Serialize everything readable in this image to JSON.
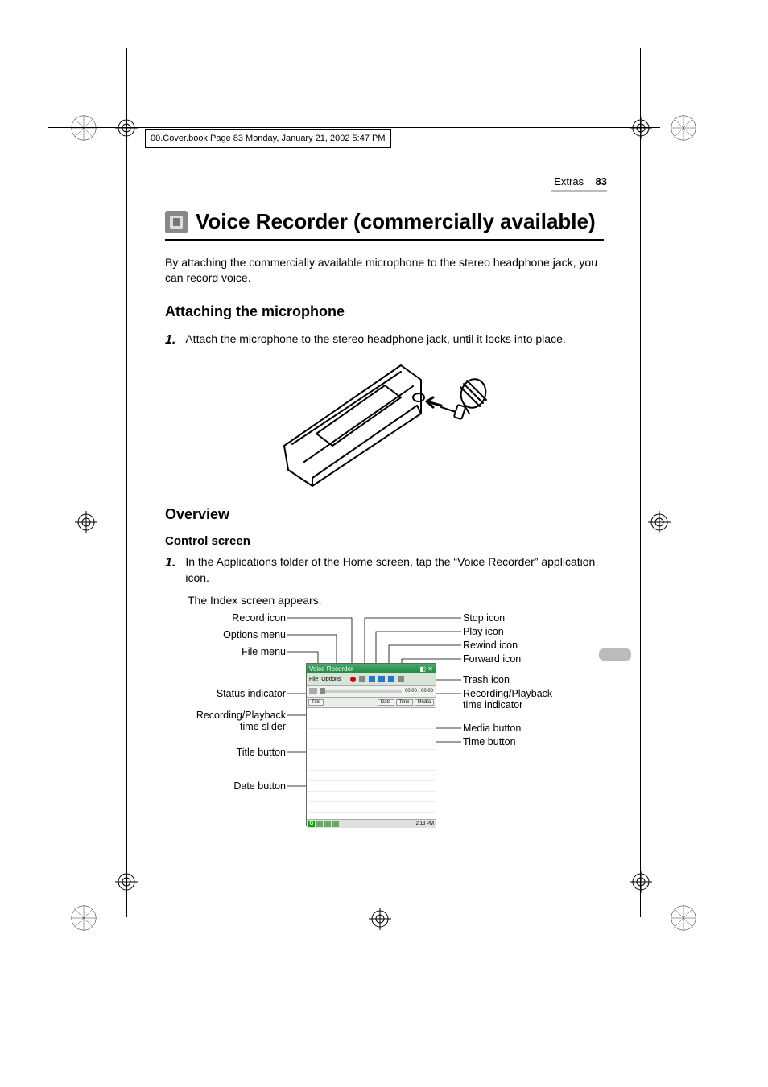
{
  "frame_header": "00.Cover.book  Page 83  Monday, January 21, 2002  5:47 PM",
  "section": {
    "label": "Extras",
    "page": "83"
  },
  "title": "Voice Recorder (commercially available)",
  "intro": "By attaching the commercially available microphone to the stereo headphone jack, you can record voice.",
  "h2_attach": "Attaching the microphone",
  "step_attach": "Attach the microphone to the stereo headphone jack, until it locks into place.",
  "h2_overview": "Overview",
  "h3_control": "Control screen",
  "step_control": "In the Applications folder of the Home screen, tap the “Voice Recorder” application icon.",
  "caption_index": "The Index screen appears.",
  "labels": {
    "left": {
      "record": "Record icon",
      "options": "Options menu",
      "file": "File menu",
      "status": "Status indicator",
      "slider": "Recording/Playback\ntime slider",
      "title_btn": "Title button",
      "date_btn": "Date button"
    },
    "right": {
      "stop": "Stop icon",
      "play": "Play icon",
      "rewind": "Rewind icon",
      "forward": "Forward icon",
      "trash": "Trash icon",
      "time_ind": "Recording/Playback\ntime indicator",
      "media_btn": "Media button",
      "time_btn": "Time button"
    }
  },
  "shot": {
    "title": "Voice Recorder",
    "menu_file": "File",
    "menu_options": "Options",
    "time": "00:00 / 00:00",
    "tab_title": "Title",
    "tab_date": "Date",
    "tab_time": "Time",
    "tab_media": "Media",
    "clock": "2:13 PM",
    "g": "G"
  }
}
